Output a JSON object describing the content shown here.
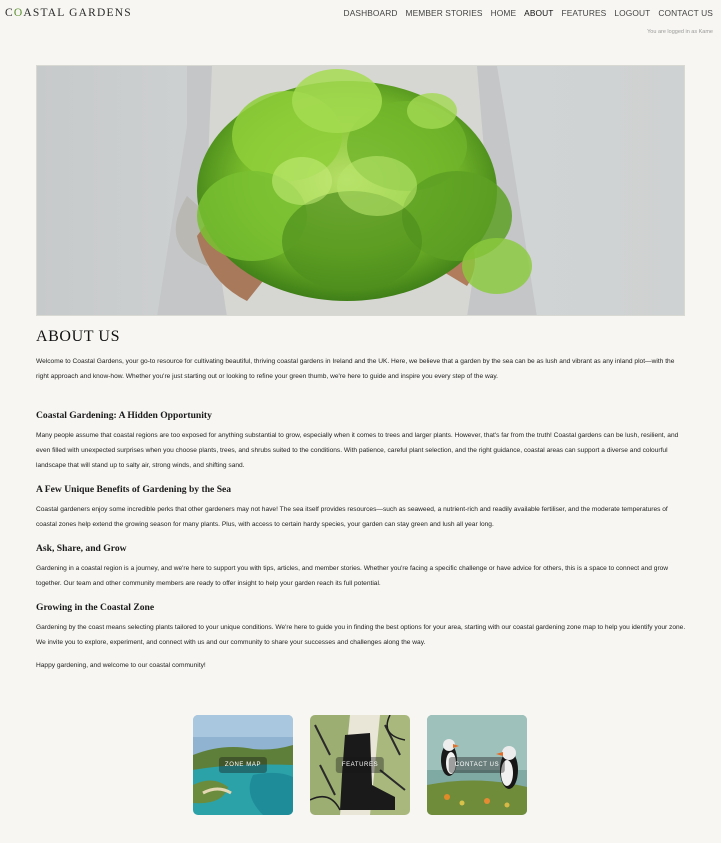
{
  "brand": {
    "name_first": "C",
    "name_o": "O",
    "name_rest": "ASTAL GARDENS"
  },
  "nav": {
    "items": [
      "DASHBOARD",
      "MEMBER STORIES",
      "HOME",
      "ABOUT",
      "FEATURES",
      "LOGOUT",
      "CONTACT US"
    ],
    "active": "ABOUT"
  },
  "session": {
    "logged_in_text": "You are logged in as Kame"
  },
  "about": {
    "title": "ABOUT US",
    "intro": "Welcome to Coastal Gardens, your go-to resource for cultivating beautiful, thriving coastal gardens in Ireland and the UK. Here, we believe that a garden by the sea can be as lush and vibrant as any inland plot—with the right approach and know-how. Whether you're just starting out or looking to refine your green thumb, we're here to guide and inspire you every step of the way.",
    "sections": [
      {
        "heading": "Coastal Gardening: A Hidden Opportunity",
        "body": "Many people assume that coastal regions are too exposed for anything substantial to grow, especially when it comes to trees and larger plants. However, that's far from the truth! Coastal gardens can be lush, resilient, and even filled with unexpected surprises when you choose plants, trees, and shrubs suited to the conditions. With patience, careful plant selection, and the right guidance, coastal areas can support a diverse and colourful landscape that will stand up to salty air, strong winds, and shifting sand."
      },
      {
        "heading": "A Few Unique Benefits of Gardening by the Sea",
        "body": "Coastal gardeners enjoy some incredible perks that other gardeners may not have! The sea itself provides resources—such as seaweed, a nutrient-rich and readily available fertiliser, and the moderate temperatures of coastal zones help extend the growing season for many plants. Plus, with access to certain hardy species, your garden can stay green and lush all year long."
      },
      {
        "heading": "Ask, Share, and Grow",
        "body": "Gardening in a coastal region is a journey, and we're here to support you with tips, articles, and member stories. Whether you're facing a specific challenge or have advice for others, this is a space to connect and grow together. Our team and other community members are ready to offer insight to help your garden reach its full potential."
      },
      {
        "heading": "Growing in the Coastal Zone",
        "body": "Gardening by the coast means selecting plants tailored to your unique conditions. We're here to guide you in finding the best options for your area, starting with our coastal gardening zone map to help you identify your zone. We invite you to explore, experiment, and connect with us and our community to share your successes and challenges along the way."
      }
    ],
    "closing": "Happy gardening, and welcome to our coastal community!"
  },
  "cards": [
    {
      "label": "ZONE MAP",
      "icon": "coastal-bay-photo"
    },
    {
      "label": "FEATURES",
      "icon": "botanical-boot-illustration"
    },
    {
      "label": "CONTACT US",
      "icon": "puffin-photo"
    }
  ],
  "colors": {
    "background": "#f7f6f2",
    "brand_accent": "#5a8f2e",
    "text": "#1d1d1d"
  }
}
